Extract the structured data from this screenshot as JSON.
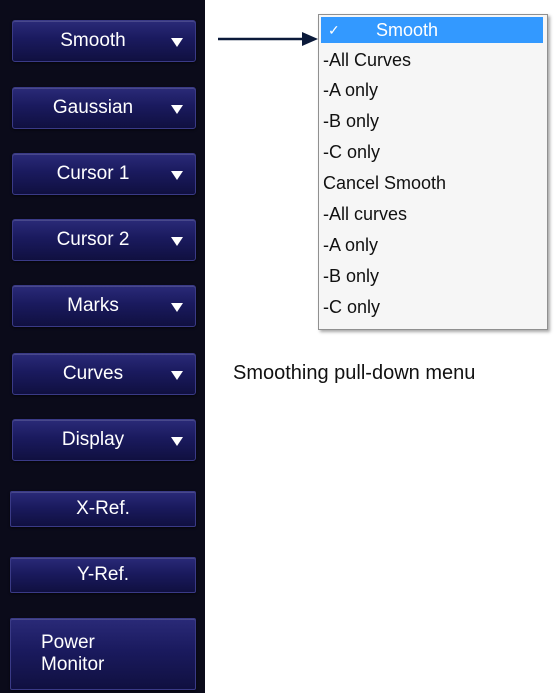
{
  "panel": {
    "buttons": [
      {
        "label": "Smooth"
      },
      {
        "label": "Gaussian"
      },
      {
        "label": "Cursor 1"
      },
      {
        "label": "Cursor 2"
      },
      {
        "label": "Marks"
      },
      {
        "label": "Curves"
      },
      {
        "label": "Display"
      },
      {
        "label": "X-Ref."
      },
      {
        "label": "Y-Ref."
      },
      {
        "label_line1": "Power",
        "label_line2": "Monitor"
      }
    ]
  },
  "menu": {
    "check_mark": "✓",
    "items": [
      "Smooth",
      "-All Curves",
      "-A only",
      "-B only",
      "-C only",
      "Cancel Smooth",
      "-All curves",
      "-A only",
      "-B only",
      "-C only"
    ]
  },
  "caption": "Smoothing pull-down menu",
  "colors": {
    "panel_bg": "#0b0b1a",
    "button": "#1a1a5e",
    "selected": "#3399ff"
  }
}
